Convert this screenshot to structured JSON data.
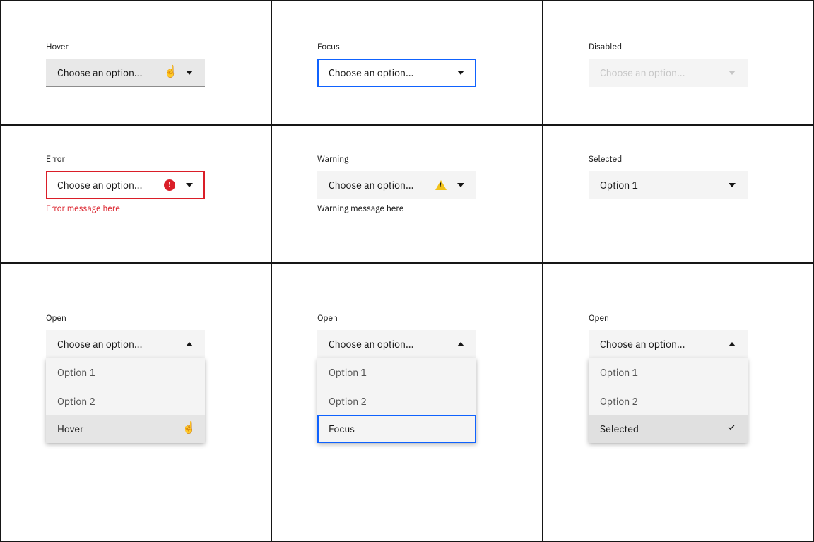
{
  "placeholder": "Choose an option...",
  "states": {
    "hover": "Hover",
    "focus": "Focus",
    "disabled": "Disabled",
    "error": "Error",
    "warning": "Warning",
    "selected": "Selected",
    "open": "Open"
  },
  "messages": {
    "error": "Error message here",
    "warning": "Warning message here"
  },
  "selected_value": "Option 1",
  "menus": {
    "hover": {
      "items": [
        "Option 1",
        "Option 2",
        "Hover"
      ]
    },
    "focus": {
      "items": [
        "Option 1",
        "Option 2",
        "Focus"
      ]
    },
    "selected": {
      "items": [
        "Option 1",
        "Option 2",
        "Selected"
      ]
    }
  }
}
